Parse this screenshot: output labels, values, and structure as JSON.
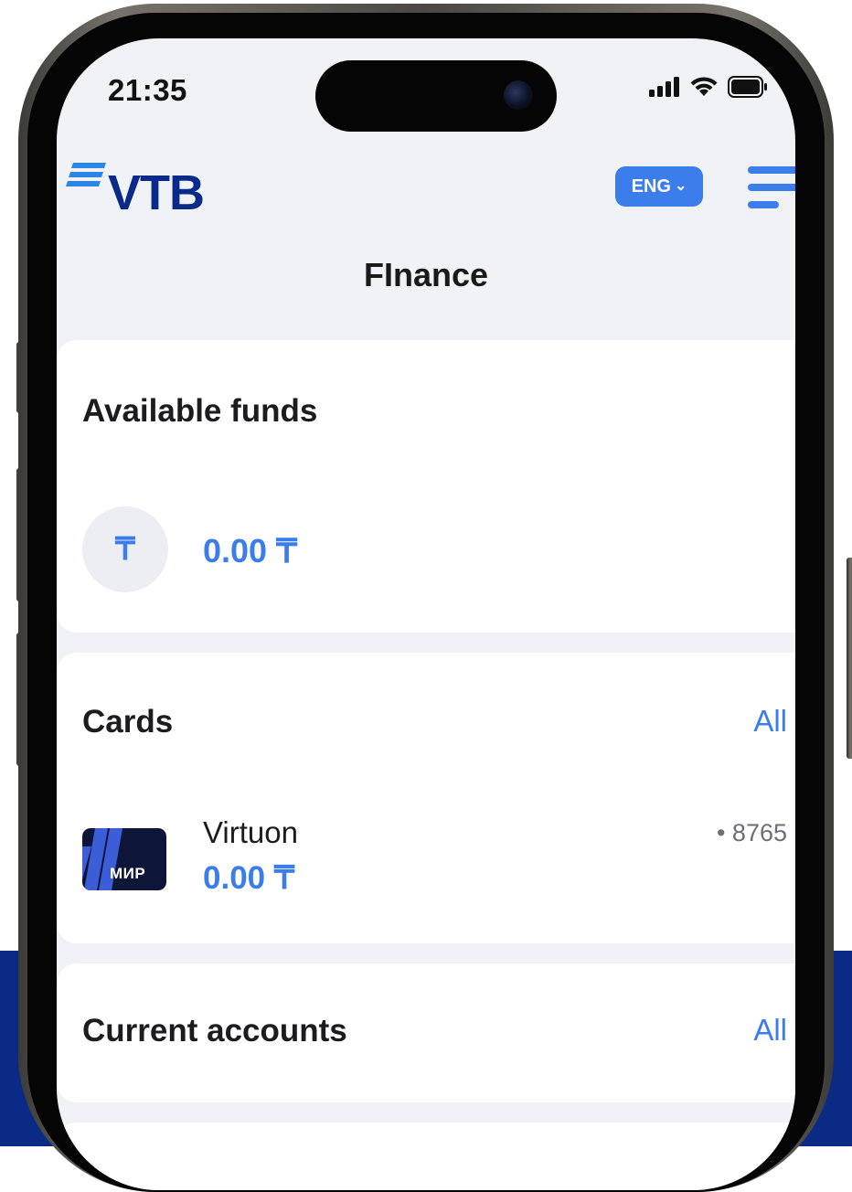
{
  "status_bar": {
    "time": "21:35"
  },
  "header": {
    "logo_text": "VTB",
    "language": "ENG",
    "language_chevron": "⌄"
  },
  "page": {
    "title": "FInance"
  },
  "available_funds": {
    "title": "Available funds",
    "currency_symbol": "₸",
    "amount": "0.00 ₸"
  },
  "cards": {
    "title": "Cards",
    "all_label": "All",
    "items": [
      {
        "name": "Virtuon",
        "amount": "0.00 ₸",
        "number": "• 8765",
        "brand": "МИР"
      }
    ]
  },
  "current_accounts": {
    "title": "Current accounts",
    "all_label": "All"
  },
  "colors": {
    "accent": "#3b7dea",
    "brand": "#0a2a8a",
    "screen_bg": "#f1f2f6",
    "band": "#0b2a86"
  }
}
